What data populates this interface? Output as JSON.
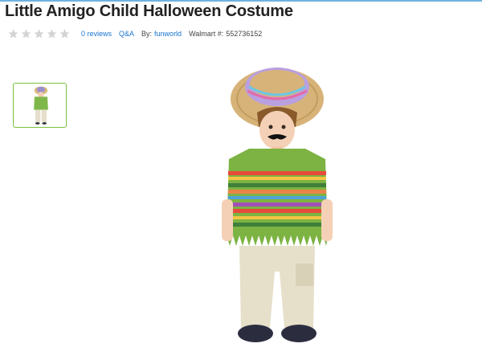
{
  "product": {
    "title": "Little Amigo Child Halloween Costume",
    "rating_stars": 0,
    "reviews_label": "0 reviews",
    "qa_label": "Q&A",
    "by_label": "By:",
    "brand": "funworld",
    "walmart_label": "Walmart #:",
    "walmart_number": "552736152"
  },
  "colors": {
    "link": "#1a75cf",
    "thumb_border": "#7cbf3f",
    "star_empty": "#d4d4d4"
  },
  "icons": {
    "star": "star-icon"
  }
}
